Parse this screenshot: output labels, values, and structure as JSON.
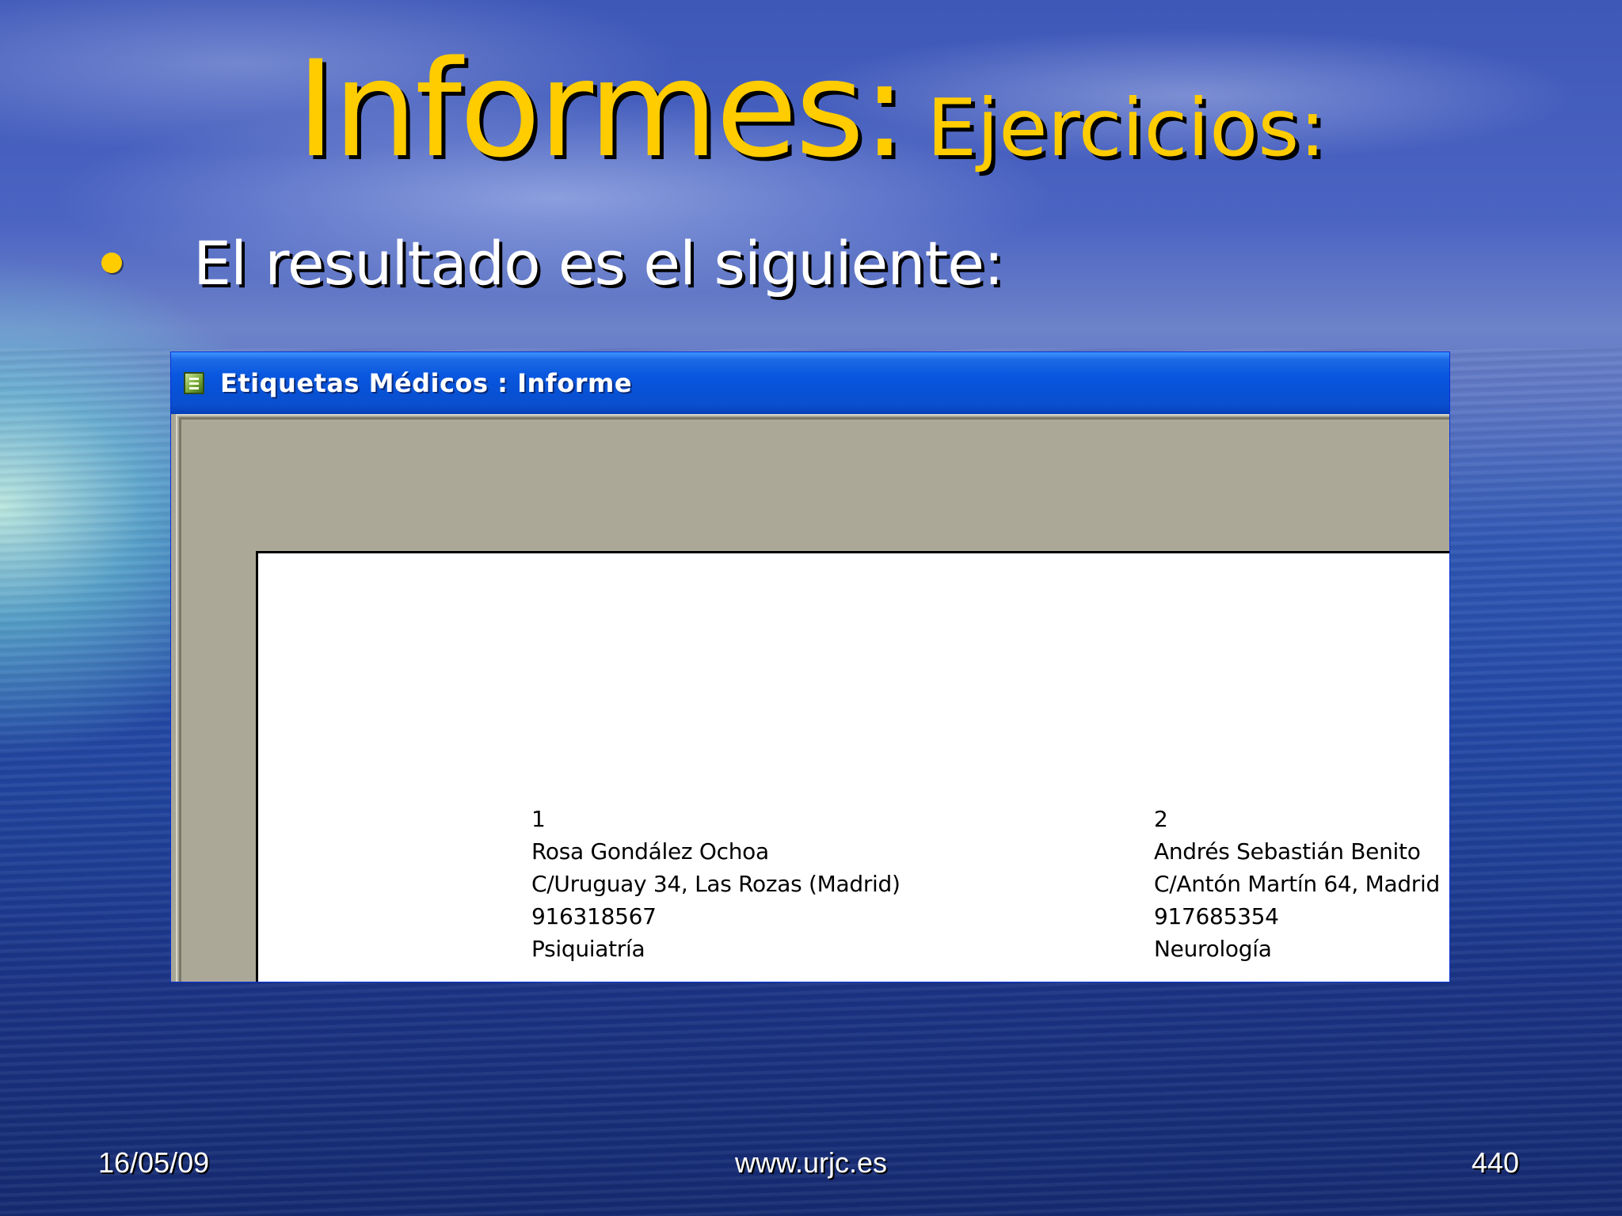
{
  "slide": {
    "title_main": "Informes:",
    "title_sub": "Ejercicios:",
    "bullet": "El resultado es el siguiente:"
  },
  "window": {
    "title": "Etiquetas Médicos : Informe",
    "icon": "report-icon"
  },
  "labels": [
    {
      "id": "1",
      "name": "Rosa Gondález Ochoa",
      "address": "C/Uruguay 34, Las Rozas (Madrid)",
      "phone": "916318567",
      "specialty": "Psiquiatría"
    },
    {
      "id": "2",
      "name": "Andrés Sebastián Benito",
      "address": "C/Antón Martín 64, Madrid",
      "phone": "917685354",
      "specialty": "Neurología"
    }
  ],
  "footer": {
    "date": "16/05/09",
    "url": "www.urjc.es",
    "page": "440"
  },
  "colors": {
    "title": "#ffcc00",
    "bullet": "#ffcc00",
    "titlebar": "#0752d6"
  }
}
